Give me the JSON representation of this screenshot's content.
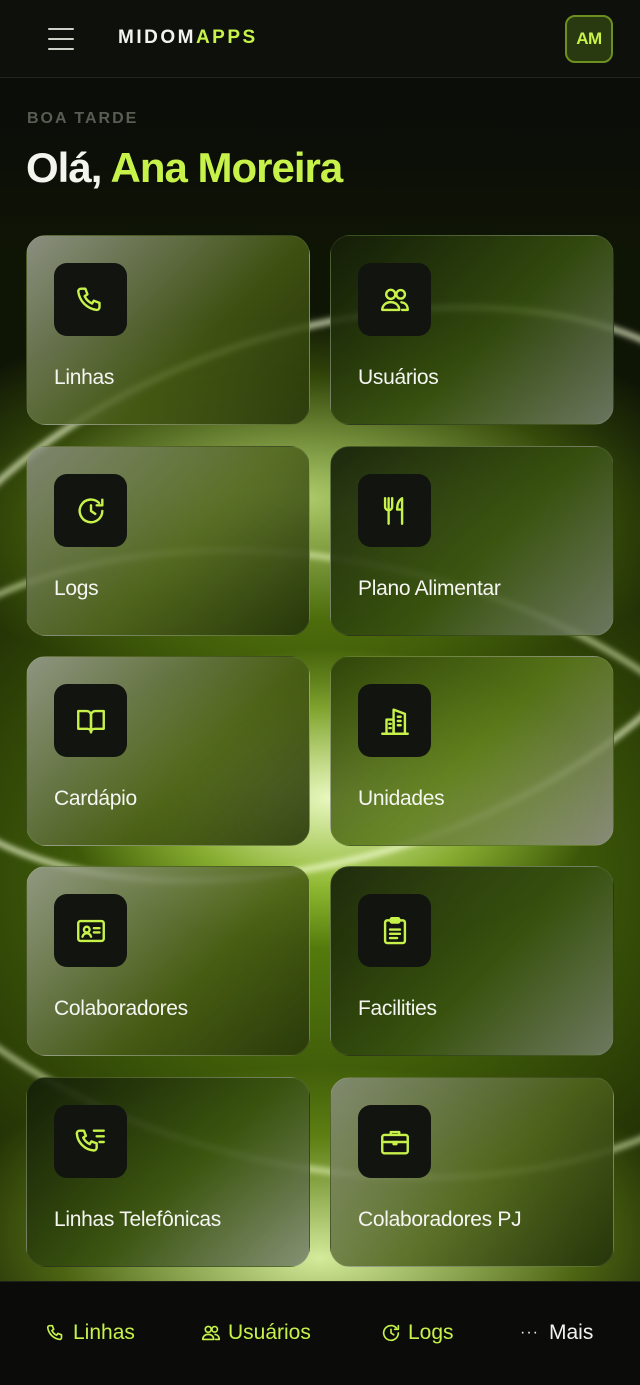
{
  "header": {
    "brand_part1": "MIDOM",
    "brand_part2": "APPS",
    "avatar_initials": "AM"
  },
  "greeting": {
    "period": "BOA TARDE",
    "hello": "Olá, ",
    "name": "Ana Moreira"
  },
  "cards": [
    {
      "label": "Linhas",
      "icon": "phone-icon"
    },
    {
      "label": "Usuários",
      "icon": "users-icon"
    },
    {
      "label": "Logs",
      "icon": "history-icon"
    },
    {
      "label": "Plano Alimentar",
      "icon": "utensils-icon"
    },
    {
      "label": "Cardápio",
      "icon": "book-open-icon"
    },
    {
      "label": "Unidades",
      "icon": "building-icon"
    },
    {
      "label": "Colaboradores",
      "icon": "id-card-icon"
    },
    {
      "label": "Facilities",
      "icon": "clipboard-icon"
    },
    {
      "label": "Linhas Telefônicas",
      "icon": "phone-list-icon"
    },
    {
      "label": "Colaboradores PJ",
      "icon": "briefcase-icon"
    }
  ],
  "bottom_nav": [
    {
      "label": "Linhas",
      "icon": "phone-icon"
    },
    {
      "label": "Usuários",
      "icon": "users-icon"
    },
    {
      "label": "Logs",
      "icon": "history-icon"
    },
    {
      "label": "Mais",
      "icon": "more-dots-icon"
    }
  ],
  "colors": {
    "accent": "#c6f24a",
    "background": "#0b0d08"
  }
}
